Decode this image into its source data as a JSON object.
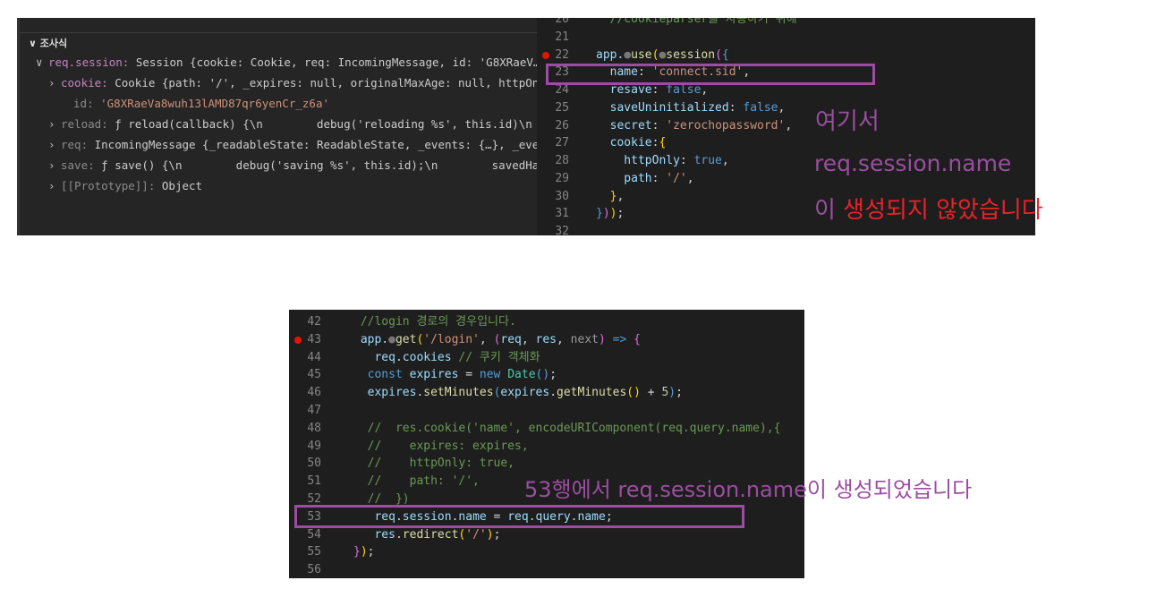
{
  "watch_panel": {
    "title": "조사식",
    "rows": [
      {
        "indent": 1,
        "twisty": "v",
        "key": "req.session",
        "keyc": "k-p",
        "value": " Session {cookie: Cookie, req: IncomingMessage, id: 'G8XRaeV…"
      },
      {
        "indent": 2,
        "twisty": ">",
        "key": "cookie",
        "keyc": "k-p",
        "value": " Cookie {path: '/', _expires: null, originalMaxAge: null, httpOn…"
      },
      {
        "indent": 3,
        "twisty": "",
        "key": "id",
        "keyc": "k-g",
        "value": " 'G8XRaeVa8wuh13lAMD87qr6yenCr_z6a'",
        "valc": "v-s"
      },
      {
        "indent": 2,
        "twisty": ">",
        "key": "reload",
        "keyc": "k-g",
        "value": " ƒ reload(callback) {\\n        debug('reloading %s', this.id)\\n …"
      },
      {
        "indent": 2,
        "twisty": ">",
        "key": "req",
        "keyc": "k-g",
        "value": " IncomingMessage {_readableState: ReadableState, _events: {…}, _eve…"
      },
      {
        "indent": 2,
        "twisty": ">",
        "key": "save",
        "keyc": "k-g",
        "value": " ƒ save() {\\n        debug('saving %s', this.id);\\n        savedHa…"
      },
      {
        "indent": 2,
        "twisty": ">",
        "key": "[[Prototype]]",
        "keyc": "k-g",
        "value": " Object"
      }
    ]
  },
  "editor_top": {
    "breakpoint_line": "22",
    "lines": [
      {
        "n": "20",
        "t": [
          [
            "  //cookieparser를 사용하기 위해",
            "c-cm"
          ]
        ]
      },
      {
        "n": "21",
        "t": []
      },
      {
        "n": "22",
        "t": [
          [
            "app.",
            "c-var"
          ],
          [
            "●",
            "c-dot"
          ],
          [
            "use",
            "c-fn"
          ],
          [
            "(",
            "c-br"
          ],
          [
            "●",
            "c-dot"
          ],
          [
            "session",
            "c-fn"
          ],
          [
            "(",
            "c-pa"
          ],
          [
            "{",
            "c-kw"
          ]
        ]
      },
      {
        "n": "23",
        "t": [
          [
            "  name",
            "c-var"
          ],
          [
            ": ",
            "c-pl"
          ],
          [
            "'connect.sid'",
            "c-str"
          ],
          [
            ",",
            "c-pl"
          ]
        ]
      },
      {
        "n": "24",
        "t": [
          [
            "  resave",
            "c-var"
          ],
          [
            ": ",
            "c-pl"
          ],
          [
            "false",
            "c-kw"
          ],
          [
            ",",
            "c-pl"
          ]
        ]
      },
      {
        "n": "25",
        "t": [
          [
            "  saveUninitialized",
            "c-var"
          ],
          [
            ": ",
            "c-pl"
          ],
          [
            "false",
            "c-kw"
          ],
          [
            ",",
            "c-pl"
          ]
        ]
      },
      {
        "n": "26",
        "t": [
          [
            "  secret",
            "c-var"
          ],
          [
            ": ",
            "c-pl"
          ],
          [
            "'zerochopassword'",
            "c-str"
          ],
          [
            ",",
            "c-pl"
          ]
        ]
      },
      {
        "n": "27",
        "t": [
          [
            "  cookie",
            "c-var"
          ],
          [
            ":",
            "c-pl"
          ],
          [
            "{",
            "c-br"
          ]
        ]
      },
      {
        "n": "28",
        "t": [
          [
            "    httpOnly",
            "c-var"
          ],
          [
            ": ",
            "c-pl"
          ],
          [
            "true",
            "c-kw"
          ],
          [
            ",",
            "c-pl"
          ]
        ]
      },
      {
        "n": "29",
        "t": [
          [
            "    path",
            "c-var"
          ],
          [
            ": ",
            "c-pl"
          ],
          [
            "'/'",
            "c-str"
          ],
          [
            ",",
            "c-pl"
          ]
        ]
      },
      {
        "n": "30",
        "t": [
          [
            "  }",
            "c-br"
          ],
          [
            ",",
            "c-pl"
          ]
        ]
      },
      {
        "n": "31",
        "t": [
          [
            "}",
            "c-kw"
          ],
          [
            ")",
            "c-pa"
          ],
          [
            ")",
            "c-br"
          ],
          [
            ";",
            "c-pl"
          ]
        ]
      },
      {
        "n": "32",
        "t": []
      }
    ]
  },
  "editor_bottom": {
    "breakpoint_line": "43",
    "lines": [
      {
        "n": "42",
        "t": [
          [
            " //login 경로의 경우입니다.",
            "c-cm"
          ]
        ]
      },
      {
        "n": "43",
        "t": [
          [
            " app.",
            "c-var"
          ],
          [
            "●",
            "c-dot"
          ],
          [
            "get",
            "c-fn"
          ],
          [
            "(",
            "c-br"
          ],
          [
            "'/login'",
            "c-str"
          ],
          [
            ", ",
            "c-pl"
          ],
          [
            "(",
            "c-pa"
          ],
          [
            "req",
            "c-var"
          ],
          [
            ", ",
            "c-pl"
          ],
          [
            "res",
            "c-var"
          ],
          [
            ", ",
            "c-pl"
          ],
          [
            "next",
            "c-gr"
          ],
          [
            ")",
            "c-pa"
          ],
          [
            " => ",
            "c-kw"
          ],
          [
            "{",
            "c-pa"
          ]
        ]
      },
      {
        "n": "44",
        "t": [
          [
            "   req",
            "c-var"
          ],
          [
            ".",
            "c-pl"
          ],
          [
            "cookies",
            "c-var"
          ],
          [
            " // 쿠키 객체화",
            "c-cm"
          ]
        ]
      },
      {
        "n": "45",
        "t": [
          [
            "  const ",
            "c-kw"
          ],
          [
            "expires",
            "c-var"
          ],
          [
            " = ",
            "c-pl"
          ],
          [
            "new ",
            "c-kw"
          ],
          [
            "Date",
            "c-cl"
          ],
          [
            "()",
            "c-kw"
          ],
          [
            ";",
            "c-pl"
          ]
        ]
      },
      {
        "n": "46",
        "t": [
          [
            "  expires",
            "c-var"
          ],
          [
            ".",
            "c-pl"
          ],
          [
            "setMinutes",
            "c-fn"
          ],
          [
            "(",
            "c-kw"
          ],
          [
            "expires",
            "c-var"
          ],
          [
            ".",
            "c-pl"
          ],
          [
            "getMinutes",
            "c-fn"
          ],
          [
            "()",
            "c-br"
          ],
          [
            " + ",
            "c-pl"
          ],
          [
            "5",
            "c-num"
          ],
          [
            ")",
            "c-kw"
          ],
          [
            ";",
            "c-pl"
          ]
        ]
      },
      {
        "n": "47",
        "t": []
      },
      {
        "n": "48",
        "t": [
          [
            "  //  res.cookie('name', encodeURIComponent(req.query.name),{",
            "c-cm"
          ]
        ]
      },
      {
        "n": "49",
        "t": [
          [
            "  //    expires: expires,",
            "c-cm"
          ]
        ]
      },
      {
        "n": "50",
        "t": [
          [
            "  //    httpOnly: true,",
            "c-cm"
          ]
        ]
      },
      {
        "n": "51",
        "t": [
          [
            "  //    path: '/',",
            "c-cm"
          ]
        ]
      },
      {
        "n": "52",
        "t": [
          [
            "  //  })",
            "c-cm"
          ]
        ]
      },
      {
        "n": "53",
        "t": [
          [
            "   req",
            "c-var"
          ],
          [
            ".",
            "c-pl"
          ],
          [
            "session",
            "c-var"
          ],
          [
            ".",
            "c-pl"
          ],
          [
            "name",
            "c-var"
          ],
          [
            " = ",
            "c-pl"
          ],
          [
            "req",
            "c-var"
          ],
          [
            ".",
            "c-pl"
          ],
          [
            "query",
            "c-var"
          ],
          [
            ".",
            "c-pl"
          ],
          [
            "name",
            "c-var"
          ],
          [
            ";",
            "c-pl"
          ]
        ]
      },
      {
        "n": "54",
        "t": [
          [
            "   res",
            "c-var"
          ],
          [
            ".",
            "c-pl"
          ],
          [
            "redirect",
            "c-fn"
          ],
          [
            "(",
            "c-br"
          ],
          [
            "'/'",
            "c-str"
          ],
          [
            ")",
            "c-br"
          ],
          [
            ";",
            "c-pl"
          ]
        ]
      },
      {
        "n": "55",
        "t": [
          [
            "}",
            "c-pa"
          ],
          [
            ")",
            "c-br"
          ],
          [
            ";",
            "c-pl"
          ]
        ]
      },
      {
        "n": "56",
        "t": []
      }
    ]
  },
  "annotations": {
    "top_line1": "여기서",
    "top_line2": "req.session.name",
    "top_line3_a": "이",
    "top_line3_b": " 생성되지 않았습니다",
    "bottom": "53행에서 req.session.name이 생성되었습니다",
    "purple": "#9b4ea0",
    "red": "#e8232a"
  }
}
